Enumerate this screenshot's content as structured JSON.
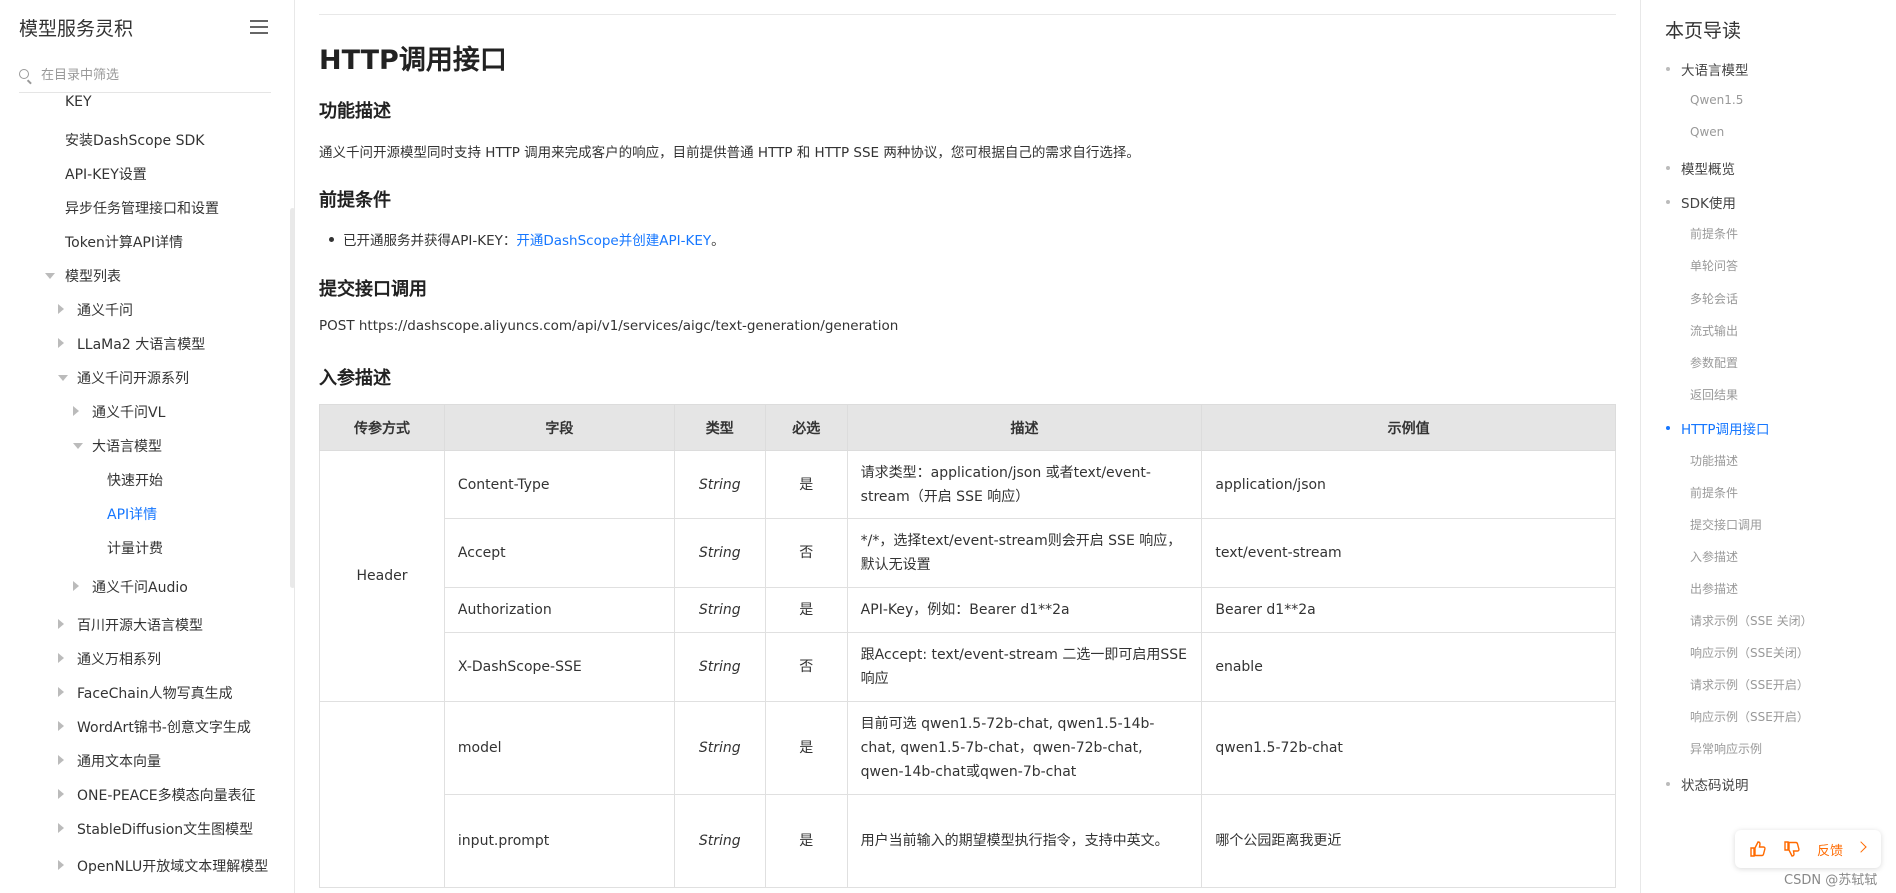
{
  "sidebar": {
    "title": "模型服务灵积",
    "filter_placeholder": "在目录中筛选",
    "items": [
      {
        "label": "KEY",
        "depth": 1,
        "arrow": "none"
      },
      {
        "label": "安装DashScope SDK",
        "depth": 1,
        "arrow": "none"
      },
      {
        "label": "API-KEY设置",
        "depth": 1,
        "arrow": "none"
      },
      {
        "label": "异步任务管理接口和设置",
        "depth": 1,
        "arrow": "none"
      },
      {
        "label": "Token计算API详情",
        "depth": 1,
        "arrow": "none"
      },
      {
        "label": "模型列表",
        "depth": 1,
        "arrow": "down"
      },
      {
        "label": "通义千问",
        "depth": 2,
        "arrow": "right"
      },
      {
        "label": "LLaMa2 大语言模型",
        "depth": 2,
        "arrow": "right"
      },
      {
        "label": "通义千问开源系列",
        "depth": 2,
        "arrow": "down"
      },
      {
        "label": "通义千问VL",
        "depth": 3,
        "arrow": "right"
      },
      {
        "label": "大语言模型",
        "depth": 3,
        "arrow": "down"
      },
      {
        "label": "快速开始",
        "depth": 4,
        "arrow": "none"
      },
      {
        "label": "API详情",
        "depth": 4,
        "arrow": "none",
        "active": true
      },
      {
        "label": "计量计费",
        "depth": 4,
        "arrow": "none"
      },
      {
        "label": "通义千问Audio",
        "depth": 3,
        "arrow": "right"
      },
      {
        "label": "百川开源大语言模型",
        "depth": 2,
        "arrow": "right"
      },
      {
        "label": "通义万相系列",
        "depth": 2,
        "arrow": "right"
      },
      {
        "label": "FaceChain人物写真生成",
        "depth": 2,
        "arrow": "right"
      },
      {
        "label": "WordArt锦书-创意文字生成",
        "depth": 2,
        "arrow": "right"
      },
      {
        "label": "通用文本向量",
        "depth": 2,
        "arrow": "right"
      },
      {
        "label": "ONE-PEACE多模态向量表征",
        "depth": 2,
        "arrow": "right"
      },
      {
        "label": "StableDiffusion文生图模型",
        "depth": 2,
        "arrow": "right"
      },
      {
        "label": "OpenNLU开放域文本理解模型",
        "depth": 2,
        "arrow": "right"
      }
    ]
  },
  "main": {
    "page_title": "HTTP调用接口",
    "sections": {
      "func_title": "功能描述",
      "func_text": "通义千问开源模型同时支持 HTTP 调用来完成客户的响应，目前提供普通 HTTP 和 HTTP SSE 两种协议，您可根据自己的需求自行选择。",
      "pre_title": "前提条件",
      "pre_text": "已开通服务并获得API-KEY：",
      "pre_link": "开通DashScope并创建API-KEY",
      "pre_after": "。",
      "submit_title": "提交接口调用",
      "submit_text": "POST https://dashscope.aliyuncs.com/api/v1/services/aigc/text-generation/generation",
      "params_title": "入参描述"
    },
    "table": {
      "headers": [
        "传参方式",
        "字段",
        "类型",
        "必选",
        "描述",
        "示例值"
      ],
      "group_header": "Header",
      "rows": [
        {
          "field": "Content-Type",
          "type": "String",
          "required": "是",
          "desc": "请求类型：application/json 或者text/event-stream（开启 SSE 响应）",
          "example": "application/json"
        },
        {
          "field": "Accept",
          "type": "String",
          "required": "否",
          "desc": "*/*，选择text/event-stream则会开启 SSE 响应，默认无设置",
          "example": "text/event-stream"
        },
        {
          "field": "Authorization",
          "type": "String",
          "required": "是",
          "desc": "API-Key，例如：Bearer d1**2a",
          "example": "Bearer d1**2a"
        },
        {
          "field": "X-DashScope-SSE",
          "type": "String",
          "required": "否",
          "desc": "跟Accept: text/event-stream 二选一即可启用SSE响应",
          "example": "enable"
        },
        {
          "field": "model",
          "type": "String",
          "required": "是",
          "desc": "目前可选 qwen1.5-72b-chat, qwen1.5-14b-chat, qwen1.5-7b-chat，qwen-72b-chat, qwen-14b-chat或qwen-7b-chat",
          "example": "qwen1.5-72b-chat"
        },
        {
          "field": "input.prompt",
          "type": "String",
          "required": "是",
          "desc": "用户当前输入的期望模型执行指令，支持中英文。",
          "example": "哪个公园距离我更近"
        }
      ]
    }
  },
  "toc": {
    "title": "本页导读",
    "items": [
      {
        "label": "大语言模型",
        "level": 1
      },
      {
        "label": "Qwen1.5",
        "level": 2
      },
      {
        "label": "Qwen",
        "level": 2
      },
      {
        "label": "模型概览",
        "level": 1
      },
      {
        "label": "SDK使用",
        "level": 1
      },
      {
        "label": "前提条件",
        "level": 2
      },
      {
        "label": "单轮问答",
        "level": 2
      },
      {
        "label": "多轮会话",
        "level": 2
      },
      {
        "label": "流式输出",
        "level": 2
      },
      {
        "label": "参数配置",
        "level": 2
      },
      {
        "label": "返回结果",
        "level": 2
      },
      {
        "label": "HTTP调用接口",
        "level": 1,
        "active": true
      },
      {
        "label": "功能描述",
        "level": 2
      },
      {
        "label": "前提条件",
        "level": 2
      },
      {
        "label": "提交接口调用",
        "level": 2
      },
      {
        "label": "入参描述",
        "level": 2
      },
      {
        "label": "出参描述",
        "level": 2
      },
      {
        "label": "请求示例（SSE 关闭）",
        "level": 2
      },
      {
        "label": "响应示例（SSE关闭）",
        "level": 2
      },
      {
        "label": "请求示例（SSE开启）",
        "level": 2
      },
      {
        "label": "响应示例（SSE开启）",
        "level": 2
      },
      {
        "label": "异常响应示例",
        "level": 2
      },
      {
        "label": "状态码说明",
        "level": 1
      }
    ]
  },
  "feedback": {
    "label": "反馈"
  },
  "watermark": "CSDN @苏轼轼",
  "colors": {
    "accent": "#1677ff",
    "feedback": "#ff6a00",
    "table_header_bg": "#e5e5e5"
  }
}
